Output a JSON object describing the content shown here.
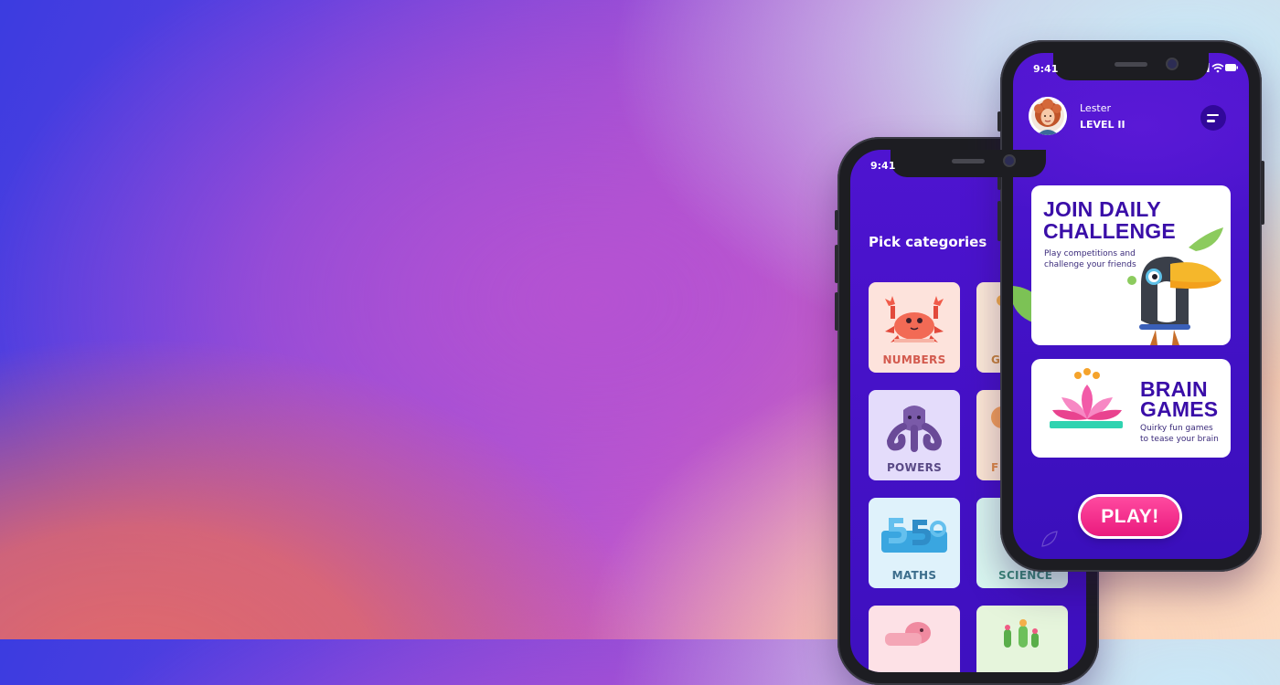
{
  "colors": {
    "brand_purple": "#4a12c9",
    "title_purple": "#3a0ea8",
    "play_pink": "#ea1a7d"
  },
  "back_phone": {
    "status_time": "9:41",
    "title": "Pick categories",
    "categories": [
      {
        "label": "NUMBERS",
        "icon": "crab-icon",
        "bg": "#fde3dc",
        "color": "#d35a4e"
      },
      {
        "label": "G",
        "icon": "gem-icon",
        "bg": "#fdebd8",
        "color": "#c9853a"
      },
      {
        "label": "POWERS",
        "icon": "octopus-icon",
        "bg": "#e4dcfb",
        "color": "#5a4a86"
      },
      {
        "label": "F",
        "icon": "fruit-icon",
        "bg": "#fde8d4",
        "color": "#e08a44"
      },
      {
        "label": "MATHS",
        "icon": "numbers-icon",
        "bg": "#dff2fb",
        "color": "#3c6d8c"
      },
      {
        "label": "SCIENCE",
        "icon": "science-icon",
        "bg": "#d8f5ef",
        "color": "#3a8a78"
      },
      {
        "label": "",
        "icon": "pig-icon",
        "bg": "#fde1e6",
        "color": "#d26c82"
      },
      {
        "label": "",
        "icon": "cactus-icon",
        "bg": "#e6f5dc",
        "color": "#5a9a4a"
      }
    ]
  },
  "front_phone": {
    "status_time": "9:41",
    "user": {
      "name": "Lester",
      "level": "LEVEL II",
      "avatar": "user-avatar"
    },
    "menu_icon": "menu-icon",
    "challenge_card": {
      "title_line1": "JOIN DAILY",
      "title_line2": "CHALLENGE",
      "desc_line1": "Play competitions and",
      "desc_line2": "challenge your friends",
      "icon": "toucan-icon"
    },
    "brain_card": {
      "title_line1": "BRAIN",
      "title_line2": "GAMES",
      "desc_line1": "Quirky fun games",
      "desc_line2": "to tease your brain",
      "icon": "lotus-icon"
    },
    "play_label": "PLAY!"
  }
}
